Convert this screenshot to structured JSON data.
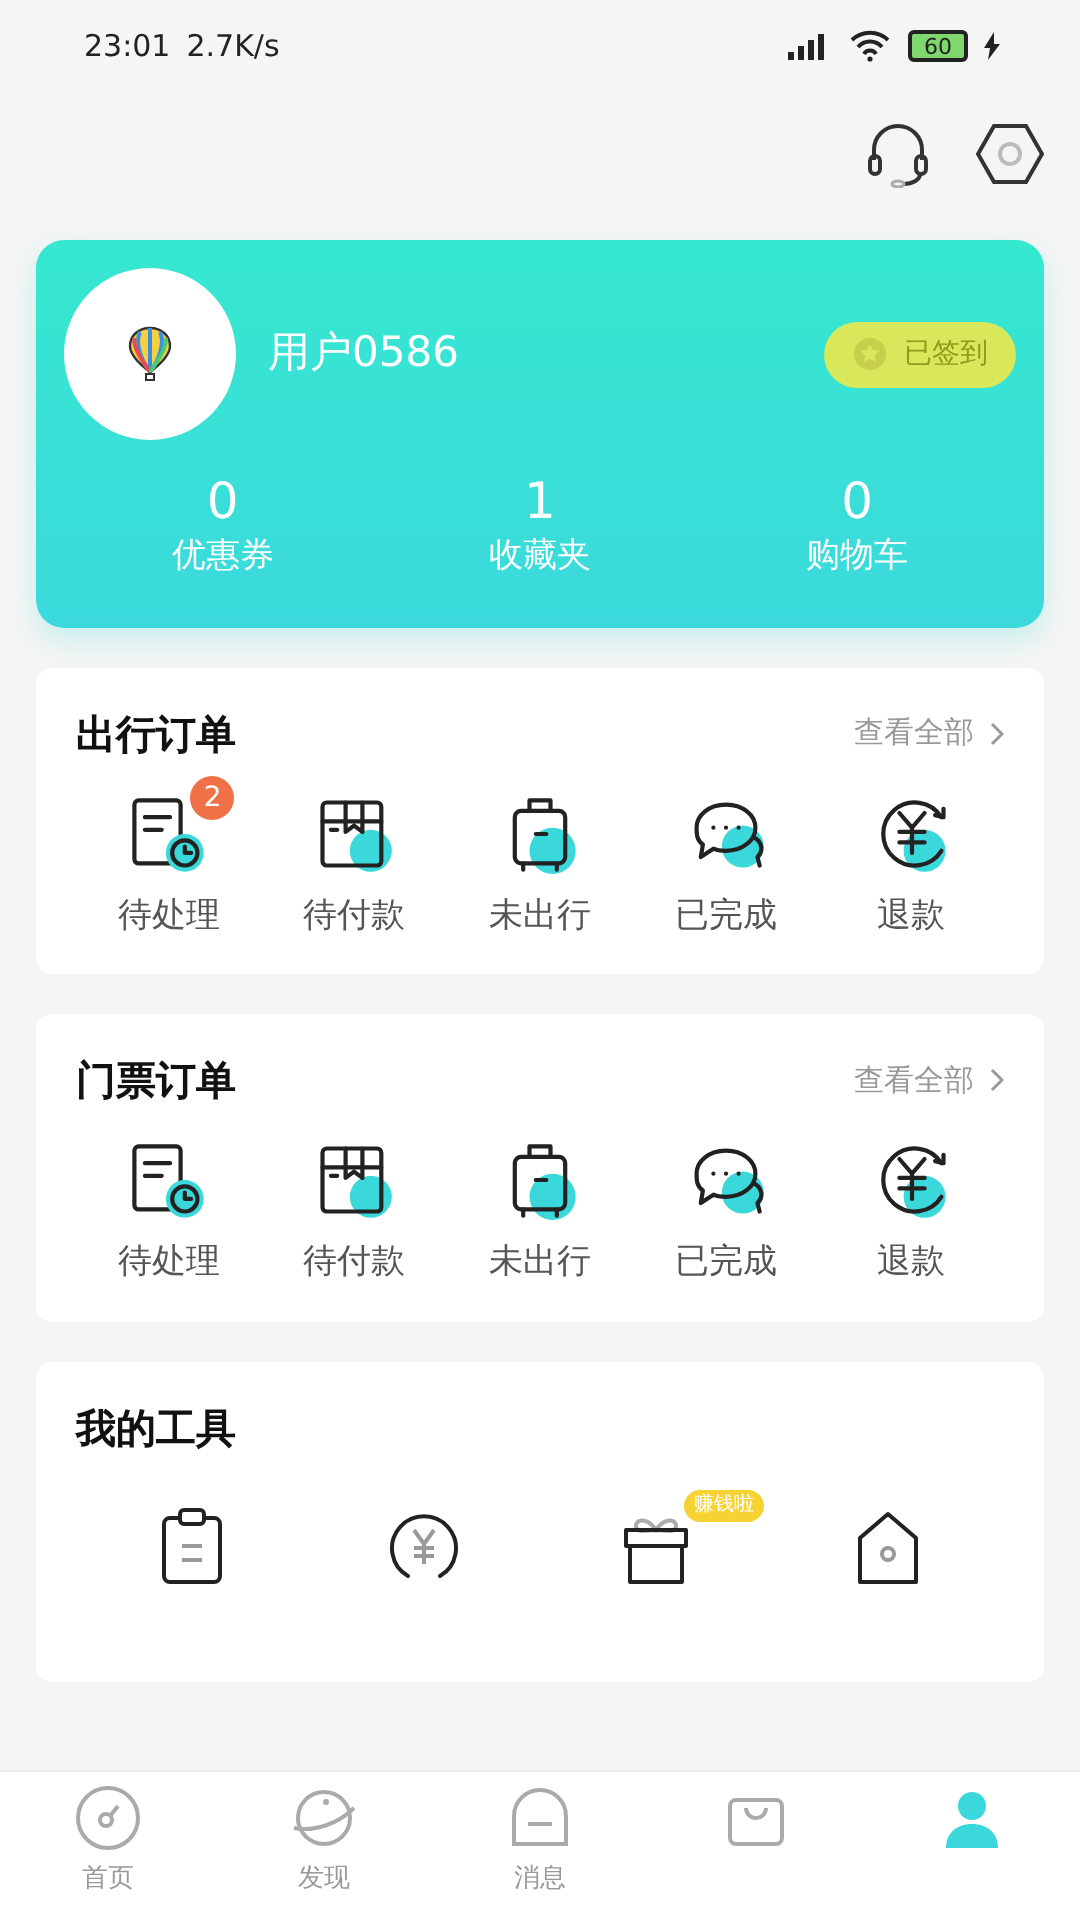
{
  "status_bar": {
    "time": "23:01",
    "speed": "2.7K/s",
    "battery": "60"
  },
  "profile": {
    "username": "用户0586",
    "checkin": "已签到",
    "stats": [
      {
        "value": "0",
        "label": "优惠券"
      },
      {
        "value": "1",
        "label": "收藏夹"
      },
      {
        "value": "0",
        "label": "购物车"
      }
    ]
  },
  "order_sections": [
    {
      "title": "出行订单",
      "view_all": "查看全部",
      "items": [
        {
          "kind": "pending",
          "label": "待处理",
          "badge": "2"
        },
        {
          "kind": "unpaid",
          "label": "待付款"
        },
        {
          "kind": "not-departed",
          "label": "未出行"
        },
        {
          "kind": "done",
          "label": "已完成"
        },
        {
          "kind": "refund",
          "label": "退款"
        }
      ]
    },
    {
      "title": "门票订单",
      "view_all": "查看全部",
      "items": [
        {
          "kind": "pending",
          "label": "待处理"
        },
        {
          "kind": "unpaid",
          "label": "待付款"
        },
        {
          "kind": "not-departed",
          "label": "未出行"
        },
        {
          "kind": "done",
          "label": "已完成"
        },
        {
          "kind": "refund",
          "label": "退款"
        }
      ]
    }
  ],
  "tools": {
    "title": "我的工具",
    "items": [
      {
        "kind": "clipboard"
      },
      {
        "kind": "yen"
      },
      {
        "kind": "gift",
        "badge": "赚钱啦"
      },
      {
        "kind": "house"
      }
    ]
  },
  "bottom_nav": [
    {
      "kind": "home",
      "label": "首页",
      "selected": false
    },
    {
      "kind": "discover",
      "label": "发现",
      "selected": false
    },
    {
      "kind": "message",
      "label": "消息",
      "selected": false
    },
    {
      "kind": "bag",
      "selected": false
    },
    {
      "kind": "user",
      "selected": true
    }
  ]
}
